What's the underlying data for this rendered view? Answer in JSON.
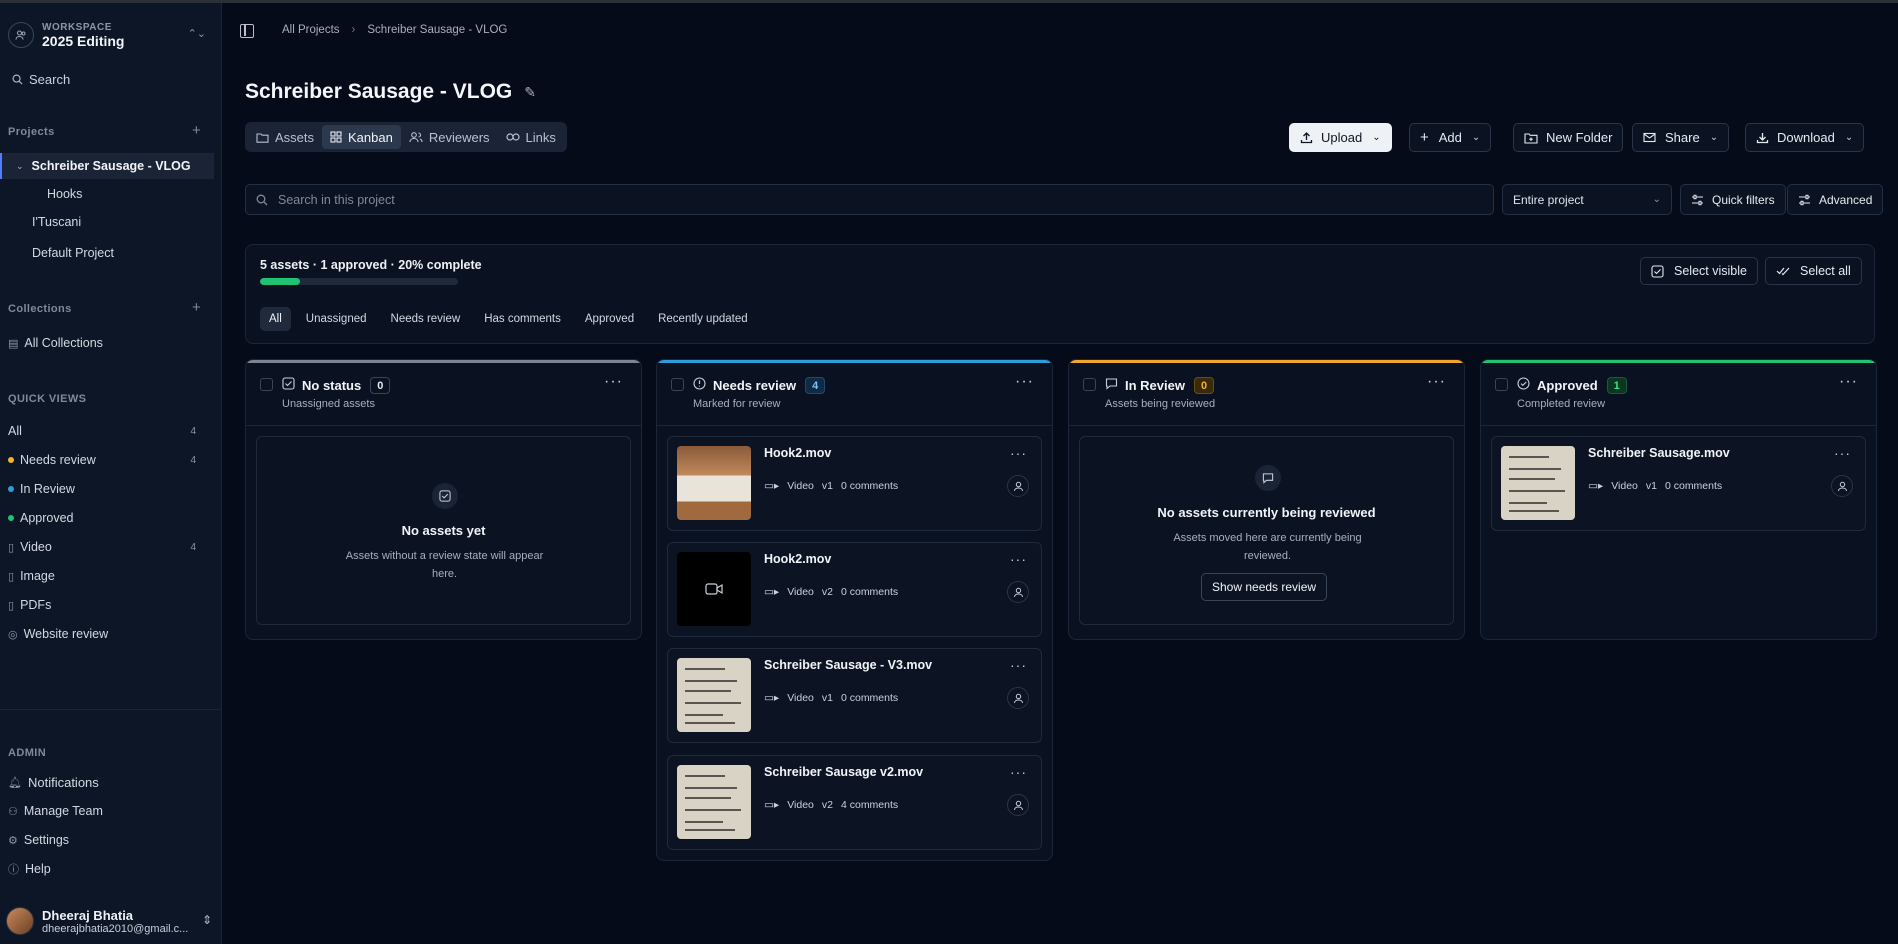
{
  "workspace": {
    "label": "WORKSPACE",
    "name": "2025 Editing"
  },
  "sidebar": {
    "search": "Search",
    "projects_label": "Projects",
    "projects": [
      {
        "label": "Schreiber Sausage - VLOG"
      },
      {
        "label": "Hooks"
      },
      {
        "label": "I'Tuscani"
      },
      {
        "label": "Default Project"
      }
    ],
    "collections_label": "Collections",
    "all_collections": "All Collections",
    "quick_views_label": "QUICK VIEWS",
    "quick_views": [
      {
        "label": "All",
        "count": "4"
      },
      {
        "label": "Needs review",
        "count": "4",
        "color": "#f0b429"
      },
      {
        "label": "In Review",
        "color": "#2d9cdb"
      },
      {
        "label": "Approved",
        "color": "#20c274"
      },
      {
        "label": "Video",
        "count": "4"
      },
      {
        "label": "Image"
      },
      {
        "label": "PDFs"
      },
      {
        "label": "Website review"
      }
    ],
    "admin_label": "ADMIN",
    "admin": [
      {
        "label": "Notifications"
      },
      {
        "label": "Manage Team"
      },
      {
        "label": "Settings"
      },
      {
        "label": "Help"
      }
    ],
    "user": {
      "name": "Dheeraj Bhatia",
      "email": "dheerajbhatia2010@gmail.c..."
    }
  },
  "breadcrumb": {
    "root": "All Projects",
    "current": "Schreiber Sausage - VLOG"
  },
  "page_title": "Schreiber Sausage - VLOG",
  "tabs": [
    "Assets",
    "Kanban",
    "Reviewers",
    "Links"
  ],
  "actions": {
    "upload": "Upload",
    "add": "Add",
    "new_folder": "New Folder",
    "share": "Share",
    "download": "Download"
  },
  "search": {
    "placeholder": "Search in this project",
    "scope": "Entire project",
    "quick_filters": "Quick filters",
    "advanced": "Advanced"
  },
  "summary": {
    "text": "5 assets · 1 approved · 20% complete",
    "progress_percent": 20,
    "select_visible": "Select visible",
    "select_all": "Select all",
    "filters": [
      "All",
      "Unassigned",
      "Needs review",
      "Has comments",
      "Approved",
      "Recently updated"
    ]
  },
  "columns": [
    {
      "title": "No status",
      "count": "0",
      "subtitle": "Unassigned assets",
      "accent": "#7d8595",
      "empty": {
        "title": "No assets yet",
        "line1": "Assets without a review state will appear",
        "line2": "here."
      }
    },
    {
      "title": "Needs review",
      "count": "4",
      "subtitle": "Marked for review",
      "accent": "#2d9cdb",
      "cards": [
        {
          "title": "Hook2.mov",
          "type": "Video",
          "version": "v1",
          "comments": "0 comments"
        },
        {
          "title": "Hook2.mov",
          "type": "Video",
          "version": "v2",
          "comments": "0 comments"
        },
        {
          "title": "Schreiber Sausage - V3.mov",
          "type": "Video",
          "version": "v1",
          "comments": "0 comments"
        },
        {
          "title": "Schreiber Sausage v2.mov",
          "type": "Video",
          "version": "v2",
          "comments": "4 comments"
        }
      ]
    },
    {
      "title": "In Review",
      "count": "0",
      "subtitle": "Assets being reviewed",
      "accent": "#f0a72b",
      "empty": {
        "title": "No assets currently being reviewed",
        "line1": "Assets moved here are currently being",
        "line2": "reviewed.",
        "button": "Show needs review"
      }
    },
    {
      "title": "Approved",
      "count": "1",
      "subtitle": "Completed review",
      "accent": "#20c274",
      "cards": [
        {
          "title": "Schreiber Sausage.mov",
          "type": "Video",
          "version": "v1",
          "comments": "0 comments"
        }
      ]
    }
  ]
}
